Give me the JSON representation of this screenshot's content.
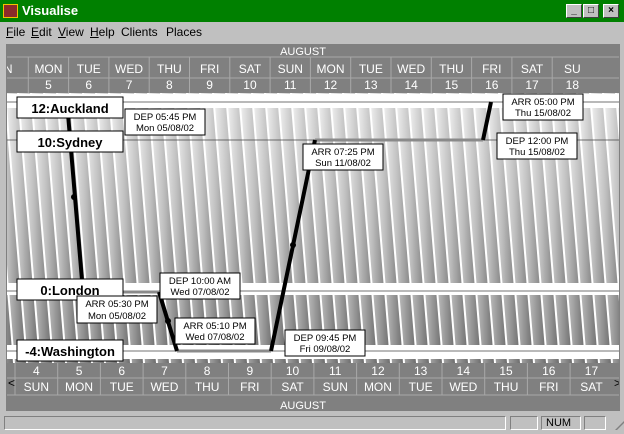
{
  "app": {
    "title": "Visualise"
  },
  "window_controls": {
    "minimize": "_",
    "maximize": "□",
    "close": "×"
  },
  "menu": {
    "items": [
      {
        "label": "File",
        "ul": "F",
        "rest": "ile"
      },
      {
        "label": "Edit",
        "ul": "E",
        "rest": "dit"
      },
      {
        "label": "View",
        "ul": "V",
        "rest": "iew"
      },
      {
        "label": "Help",
        "ul": "H",
        "rest": "elp"
      },
      {
        "label": "Clients",
        "ul": "",
        "rest": "Clients"
      },
      {
        "label": "Places",
        "ul": "",
        "rest": "Places"
      }
    ]
  },
  "timeline": {
    "month_label_top": "AUGUST",
    "month_label_bottom": "AUGUST",
    "top_weekdays": [
      "N",
      "MON",
      "TUE",
      "WED",
      "THU",
      "FRI",
      "SAT",
      "SUN",
      "MON",
      "TUE",
      "WED",
      "THU",
      "FRI",
      "SAT",
      "SU"
    ],
    "top_dates": [
      "",
      "5",
      "6",
      "7",
      "8",
      "9",
      "10",
      "11",
      "12",
      "13",
      "14",
      "15",
      "16",
      "17",
      "18"
    ],
    "bottom_dates": [
      "4",
      "5",
      "6",
      "7",
      "8",
      "9",
      "10",
      "11",
      "12",
      "13",
      "14",
      "15",
      "16",
      "17"
    ],
    "bottom_weekdays": [
      "SUN",
      "MON",
      "TUE",
      "WED",
      "THU",
      "FRI",
      "SAT",
      "SUN",
      "MON",
      "TUE",
      "WED",
      "THU",
      "FRI",
      "SAT"
    ],
    "scroll_left": "<",
    "scroll_right": ">"
  },
  "places": [
    {
      "label": "12:Auckland"
    },
    {
      "label": "10:Sydney"
    },
    {
      "label": "0:London"
    },
    {
      "label": "-4:Washington"
    }
  ],
  "events": [
    {
      "line1": "DEP 05:45 PM",
      "line2": "Mon 05/08/02"
    },
    {
      "line1": "ARR 05:30 PM",
      "line2": "Mon 05/08/02"
    },
    {
      "line1": "DEP 10:00 AM",
      "line2": "Wed 07/08/02"
    },
    {
      "line1": "ARR 05:10 PM",
      "line2": "Wed 07/08/02"
    },
    {
      "line1": "DEP 09:45 PM",
      "line2": "Fri 09/08/02"
    },
    {
      "line1": "ARR 07:25 PM",
      "line2": "Sun 11/08/02"
    },
    {
      "line1": "DEP 12:00 PM",
      "line2": "Thu 15/08/02"
    },
    {
      "line1": "ARR 05:00 PM",
      "line2": "Thu 15/08/02"
    }
  ],
  "status": {
    "num": "NUM"
  }
}
